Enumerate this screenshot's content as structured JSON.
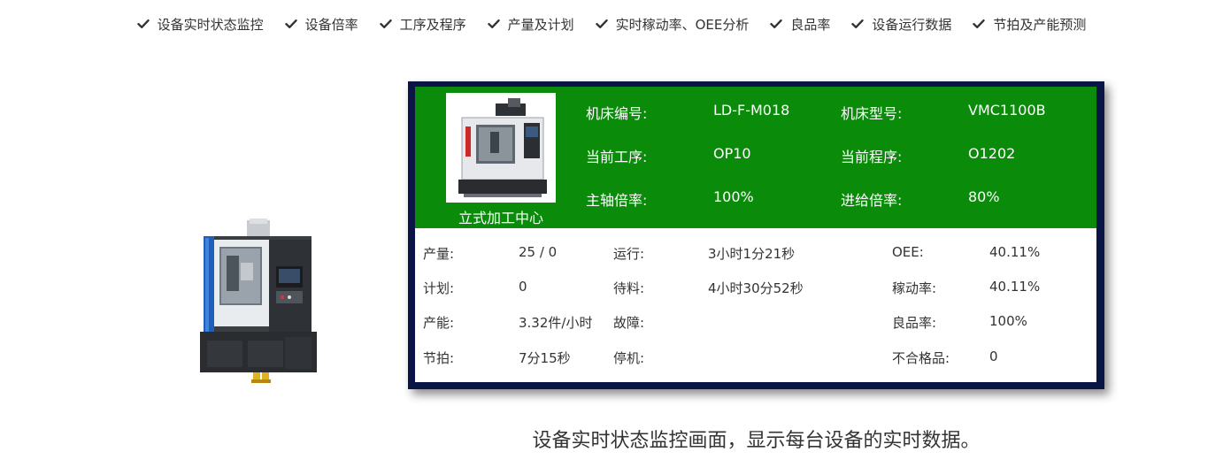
{
  "feature_nav": {
    "items": [
      {
        "label": "设备实时状态监控"
      },
      {
        "label": "设备倍率"
      },
      {
        "label": "工序及程序"
      },
      {
        "label": "产量及计划"
      },
      {
        "label": "实时稼动率、OEE分析"
      },
      {
        "label": "良品率"
      },
      {
        "label": "设备运行数据"
      },
      {
        "label": "节拍及产能预测"
      }
    ],
    "icon": "check-icon"
  },
  "dashboard": {
    "machine_caption": "立式加工中心",
    "header": {
      "machine_no_label": "机床编号:",
      "machine_no_value": "LD-F-M018",
      "machine_model_label": "机床型号:",
      "machine_model_value": "VMC1100B",
      "current_process_label": "当前工序:",
      "current_process_value": "OP10",
      "current_program_label": "当前程序:",
      "current_program_value": "O1202",
      "spindle_rate_label": "主轴倍率:",
      "spindle_rate_value": "100%",
      "feed_rate_label": "进给倍率:",
      "feed_rate_value": "80%"
    },
    "stats": {
      "output_label": "产量:",
      "output_value": "25 / 0",
      "running_label": "运行:",
      "running_value": "3小时1分21秒",
      "oee_label": "OEE:",
      "oee_value": "40.11%",
      "plan_label": "计划:",
      "plan_value": "0",
      "waiting_label": "待料:",
      "waiting_value": "4小时30分52秒",
      "utilization_label": "稼动率:",
      "utilization_value": "40.11%",
      "capacity_label": "产能:",
      "capacity_value": "3.32件/小时",
      "fault_label": "故障:",
      "fault_value": "",
      "yield_label": "良品率:",
      "yield_value": "100%",
      "takt_label": "节拍:",
      "takt_value": "7分15秒",
      "stop_label": "停机:",
      "stop_value": "",
      "defect_label": "不合格品:",
      "defect_value": "0"
    }
  },
  "caption": "设备实时状态监控画面，显示每台设备的实时数据。",
  "colors": {
    "header_green": "#0a8c0a",
    "panel_border": "#0a1445",
    "text": "#333333"
  }
}
